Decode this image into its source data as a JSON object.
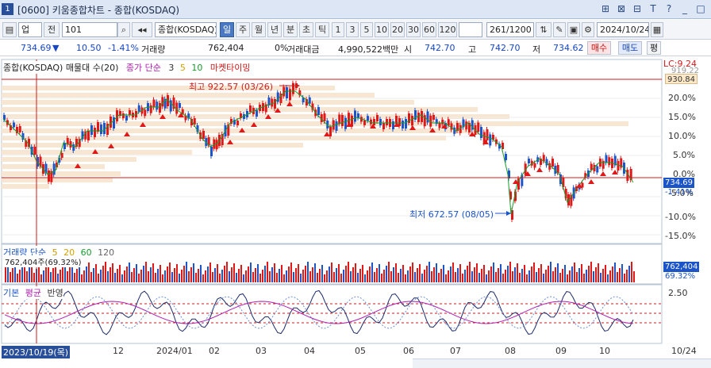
{
  "window": {
    "number": "1",
    "title": "[0600] 키움종합차트 - 종합(KOSDAQ)",
    "controls": [
      "⊞",
      "⊠",
      "⊟",
      "T",
      "?",
      "_",
      "□"
    ]
  },
  "toolbar": {
    "market": "업",
    "market_prev": "전",
    "code": "101",
    "name": "종합(KOSDAQ)",
    "periods": [
      "일",
      "주",
      "월",
      "년",
      "분",
      "초",
      "틱"
    ],
    "active_period": "일",
    "intervals": [
      "1",
      "3",
      "5",
      "10",
      "20",
      "30",
      "60",
      "120"
    ],
    "count": "261",
    "count_total": "/1200",
    "date": "2024/10/24"
  },
  "quote": {
    "price": "734.69",
    "change": "10.50",
    "change_pct": "-1.41%",
    "volume_label": "거래량",
    "volume": "762,404",
    "volume_pct": "0%",
    "amount_label": "거래대금",
    "amount": "4,990,522백만",
    "open_label": "시",
    "open": "742.70",
    "high_label": "고",
    "high": "742.70",
    "low_label": "저",
    "low": "734.62",
    "buy": "매수",
    "sell": "매도",
    "extra": "평"
  },
  "price_panel": {
    "legend_title": "종합(KOSDAQ) 매물대 수(20)",
    "ma_label": "종가 단순",
    "ma_periods": [
      "3",
      "5",
      "10"
    ],
    "market_timing": "마켓타이밍",
    "lc_label": "LC:9.24",
    "high_note": "최고 922.57 (03/26)",
    "low_note": "최저 672.57 (08/05)",
    "top_price": "930.84",
    "current_price": "734.69",
    "current_pct": "-1.41%",
    "y_ticks": [
      "20.0%",
      "15.0%",
      "10.0%",
      "5.0%",
      "0.0%",
      "-5.0%",
      "-10.0%",
      "-15.0%"
    ],
    "ref_top": "919.22"
  },
  "volume_panel": {
    "legend": "거래량 단순",
    "ma_periods": [
      "5",
      "20",
      "60",
      "120"
    ],
    "value_note": "762,404주(69.32%)",
    "right_value": "762,404",
    "right_pct": "69.32%"
  },
  "osc_panel": {
    "legend": [
      "기본",
      "평균",
      "반영"
    ],
    "top_value": "2.50"
  },
  "xaxis": {
    "cursor_date": "2023/10/19(목)",
    "labels": [
      "12",
      "2024/01",
      "02",
      "03",
      "04",
      "05",
      "06",
      "07",
      "08",
      "09",
      "10"
    ],
    "right_label": "10/24"
  },
  "colors": {
    "up": "#e01818",
    "down": "#1c54c9",
    "ma_green": "#169c2c",
    "accent": "#4a78c2"
  }
}
